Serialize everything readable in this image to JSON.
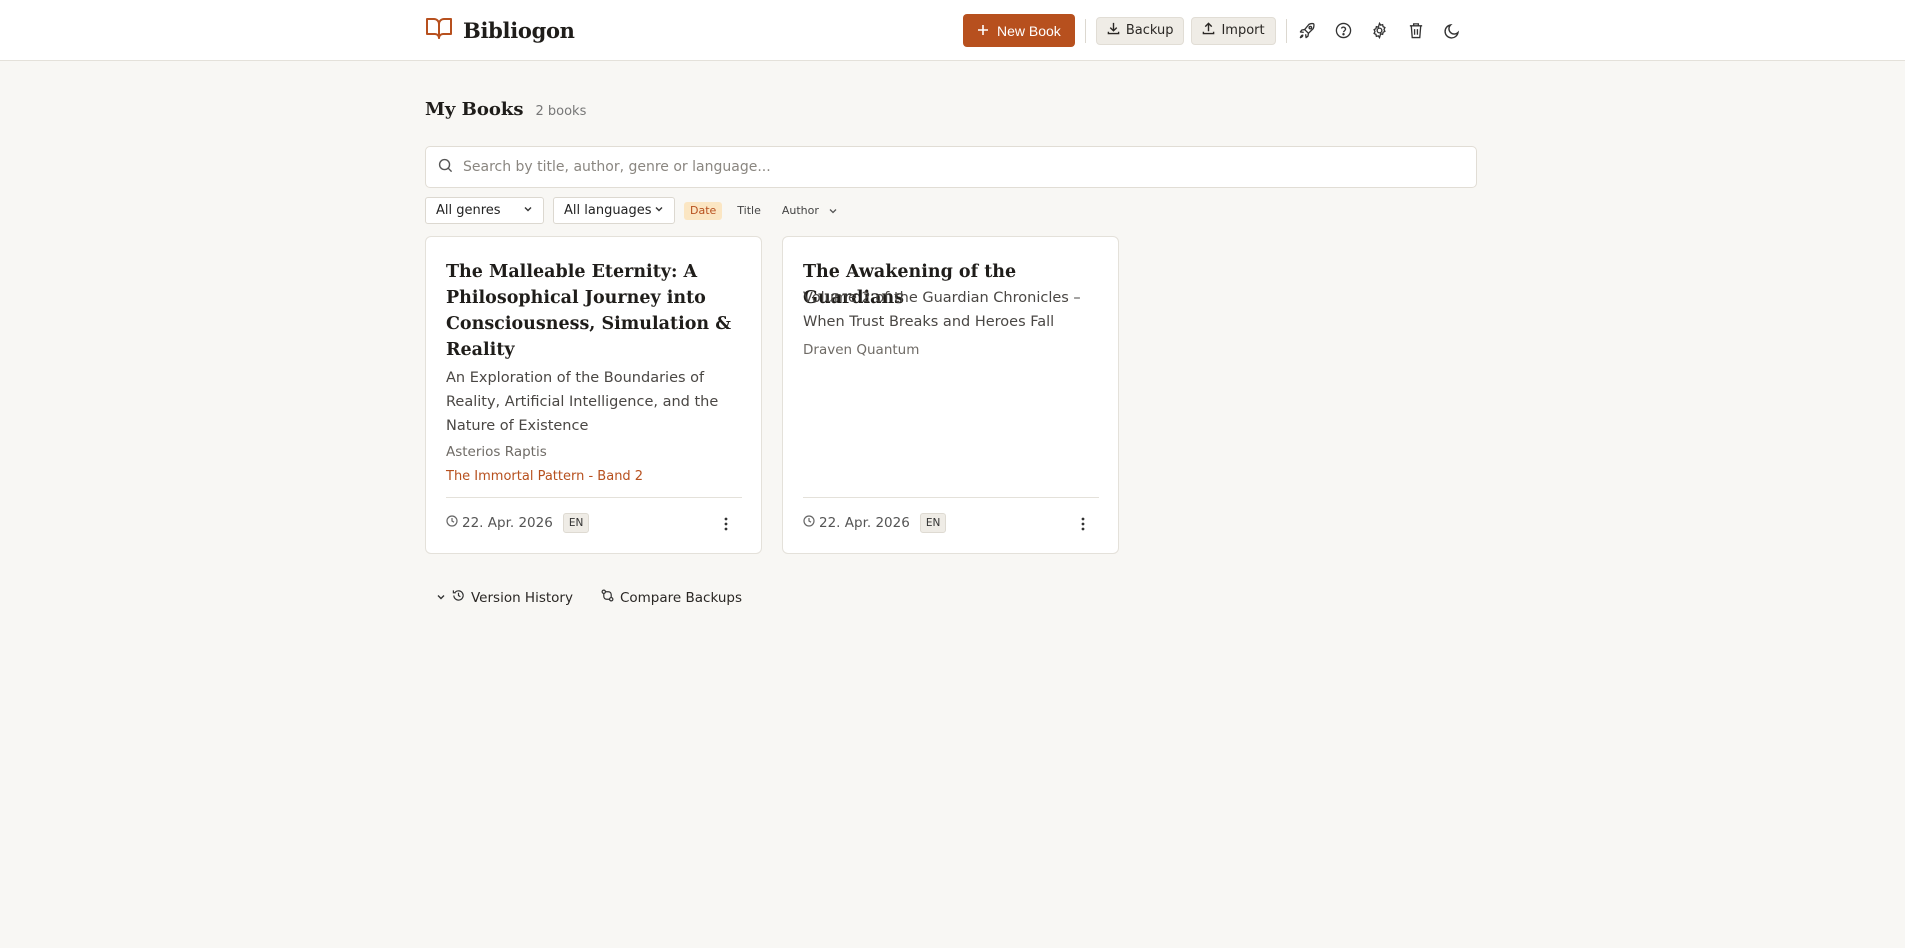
{
  "header": {
    "brand": "Bibliogon",
    "new_book_label": "New Book",
    "backup_label": "Backup",
    "import_label": "Import"
  },
  "page": {
    "title": "My Books",
    "count": "2 books"
  },
  "search": {
    "placeholder": "Search by title, author, genre or language..."
  },
  "filters": {
    "genre": "All genres",
    "language": "All languages",
    "sort": [
      "Date",
      "Title",
      "Author"
    ],
    "active_sort": "Date"
  },
  "books": [
    {
      "title": "The Malleable Eternity: A Philosophical Journey into Consciousness, Simulation & Reality",
      "subtitle": "An Exploration of the Boundaries of Reality, Artificial Intelligence, and the Nature of Existence",
      "author": "Asterios Raptis",
      "series": "The Immortal Pattern - Band 2",
      "date": "22. Apr. 2026",
      "language": "EN"
    },
    {
      "title": "The Awakening of the Guardians",
      "subtitle": "Volume 2 of the Guardian Chronicles – When Trust Breaks and Heroes Fall",
      "author": "Draven Quantum",
      "series": "",
      "date": "22. Apr. 2026",
      "language": "EN"
    }
  ],
  "footer_links": {
    "version_history": "Version History",
    "compare_backups": "Compare Backups"
  },
  "colors": {
    "accent": "#b7501e",
    "background": "#f8f7f4",
    "active_sort_bg": "#fbe6c3"
  },
  "icons": [
    "book-logo-icon",
    "plus-icon",
    "download-icon",
    "upload-icon",
    "rocket-icon",
    "help-icon",
    "gear-icon",
    "trash-icon",
    "moon-icon",
    "search-icon",
    "chevron-down-icon",
    "clock-icon",
    "more-vertical-icon",
    "history-icon",
    "compare-icon"
  ]
}
